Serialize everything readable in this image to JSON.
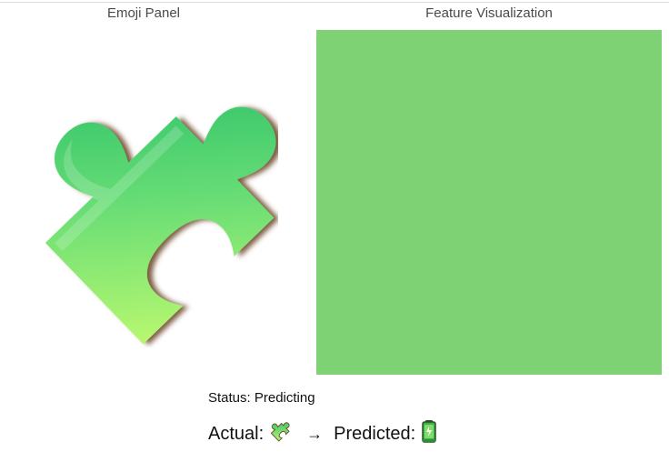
{
  "panels": {
    "emoji_title": "Emoji Panel",
    "viz_title": "Feature Visualization",
    "emoji_icon": "puzzle-piece-icon",
    "viz_color": "#7fd273"
  },
  "status": {
    "text": "Status: Predicting"
  },
  "prediction": {
    "actual_label": "Actual:",
    "actual_icon": "puzzle-piece-icon",
    "arrow": "→",
    "predicted_label": "Predicted:",
    "predicted_icon": "battery-icon"
  },
  "colors": {
    "puzzle_light": "#b8f870",
    "puzzle_dark": "#19b866",
    "puzzle_edge": "#6f4b2f",
    "feature_green": "#7fd273",
    "battery_green": "#3bb54a",
    "battery_dark": "#2e4f2a"
  }
}
